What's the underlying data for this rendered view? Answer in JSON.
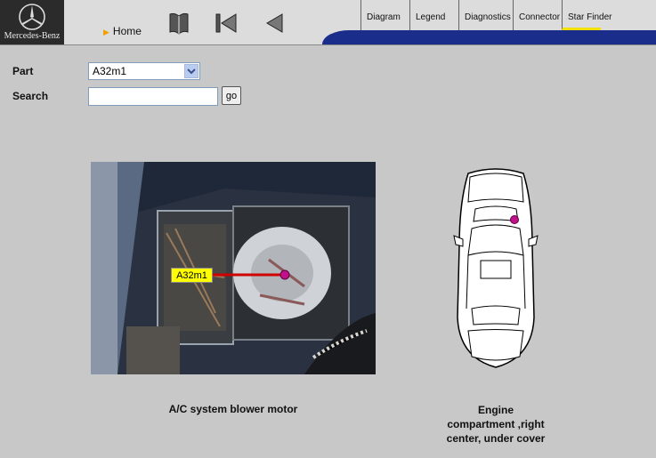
{
  "brand": {
    "name": "Mercedes-Benz"
  },
  "nav": {
    "home_label": "Home",
    "icons": [
      "book-icon",
      "skip-first-icon",
      "back-icon"
    ]
  },
  "tabs": [
    {
      "label": "Diagram"
    },
    {
      "label": "Legend"
    },
    {
      "label": "Diagnostics"
    },
    {
      "label": "Connector"
    },
    {
      "label": "Star Finder",
      "active": true
    }
  ],
  "form": {
    "part_label": "Part",
    "part_value": "A32m1",
    "search_label": "Search",
    "search_value": "",
    "go_label": "go"
  },
  "photo": {
    "callout": "A32m1",
    "caption": "A/C system blower motor"
  },
  "location": {
    "caption_lines": [
      "Engine",
      "compartment ,right",
      "center, under cover"
    ]
  },
  "colors": {
    "background": "#c8c8c8",
    "tab_strip": "#1a2d8a",
    "active_tab_marker": "#f4e000",
    "marker": "#c0108a",
    "callout": "#ffff00"
  }
}
